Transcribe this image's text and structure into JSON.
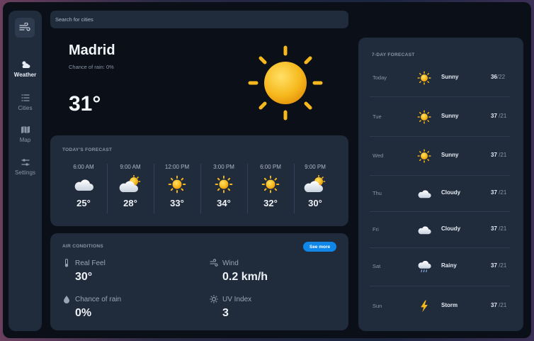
{
  "search": {
    "placeholder": "Search for cities"
  },
  "sidebar": {
    "items": [
      {
        "label": "Weather",
        "icon": "cloud-sun-icon"
      },
      {
        "label": "Cities",
        "icon": "list-icon"
      },
      {
        "label": "Map",
        "icon": "map-icon"
      },
      {
        "label": "Settings",
        "icon": "sliders-icon"
      }
    ]
  },
  "current": {
    "city": "Madrid",
    "rain_chance": "Chance of rain: 0%",
    "temperature": "31°",
    "icon": "sun-icon"
  },
  "today_forecast": {
    "title": "TODAY'S FORECAST",
    "hours": [
      {
        "time": "6:00 AM",
        "icon": "cloud-icon",
        "temp": "25°"
      },
      {
        "time": "9:00 AM",
        "icon": "partly-cloudy-icon",
        "temp": "28°"
      },
      {
        "time": "12:00 PM",
        "icon": "sun-icon",
        "temp": "33°"
      },
      {
        "time": "3:00 PM",
        "icon": "sun-icon",
        "temp": "34°"
      },
      {
        "time": "6:00 PM",
        "icon": "sun-icon",
        "temp": "32°"
      },
      {
        "time": "9:00 PM",
        "icon": "partly-cloudy-icon",
        "temp": "30°"
      }
    ]
  },
  "air_conditions": {
    "title": "AIR CONDITIONS",
    "see_more": "See more",
    "items": [
      {
        "label": "Real Feel",
        "value": "30°",
        "icon": "thermometer-icon"
      },
      {
        "label": "Wind",
        "value": "0.2 km/h",
        "icon": "wind-icon"
      },
      {
        "label": "Chance of rain",
        "value": "0%",
        "icon": "droplet-icon"
      },
      {
        "label": "UV Index",
        "value": "3",
        "icon": "sun-small-icon"
      }
    ]
  },
  "week_forecast": {
    "title": "7-DAY FORECAST",
    "days": [
      {
        "day": "Today",
        "icon": "sun-icon",
        "condition": "Sunny",
        "high": "36",
        "low": "/22"
      },
      {
        "day": "Tue",
        "icon": "sun-icon",
        "condition": "Sunny",
        "high": "37",
        "low": "/21"
      },
      {
        "day": "Wed",
        "icon": "sun-icon",
        "condition": "Sunny",
        "high": "37",
        "low": "/21"
      },
      {
        "day": "Thu",
        "icon": "cloud-icon",
        "condition": "Cloudy",
        "high": "37",
        "low": "/21"
      },
      {
        "day": "Fri",
        "icon": "cloud-icon",
        "condition": "Cloudy",
        "high": "37",
        "low": "/21"
      },
      {
        "day": "Sat",
        "icon": "rain-cloud-icon",
        "condition": "Rainy",
        "high": "37",
        "low": "/21"
      },
      {
        "day": "Sun",
        "icon": "lightning-icon",
        "condition": "Storm",
        "high": "37",
        "low": "/21"
      }
    ]
  },
  "colors": {
    "accent": "#0f86e8",
    "panel": "#202b3b",
    "background": "#0b1018",
    "sun": "#f6b81c"
  }
}
